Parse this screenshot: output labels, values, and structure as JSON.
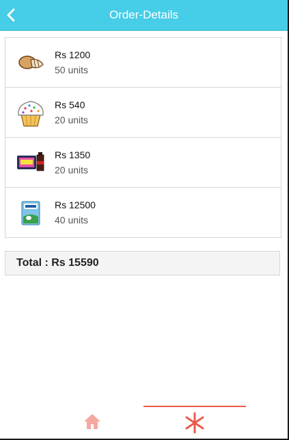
{
  "header": {
    "title": "Order-Details"
  },
  "items": [
    {
      "price": "Rs 1200",
      "units": "50 units",
      "icon": "bread-icon"
    },
    {
      "price": "Rs 540",
      "units": "20 units",
      "icon": "cupcake-icon"
    },
    {
      "price": "Rs 1350",
      "units": "20 units",
      "icon": "snacks-drink-icon"
    },
    {
      "price": "Rs 12500",
      "units": "40 units",
      "icon": "milk-pack-icon"
    }
  ],
  "total": {
    "text": "Total : Rs 15590"
  },
  "nav": {
    "home_icon": "home-icon",
    "active_icon": "asterisk-icon"
  },
  "colors": {
    "header": "#46cde7",
    "accent": "#ea5a4c",
    "home": "#f5a8a0"
  }
}
